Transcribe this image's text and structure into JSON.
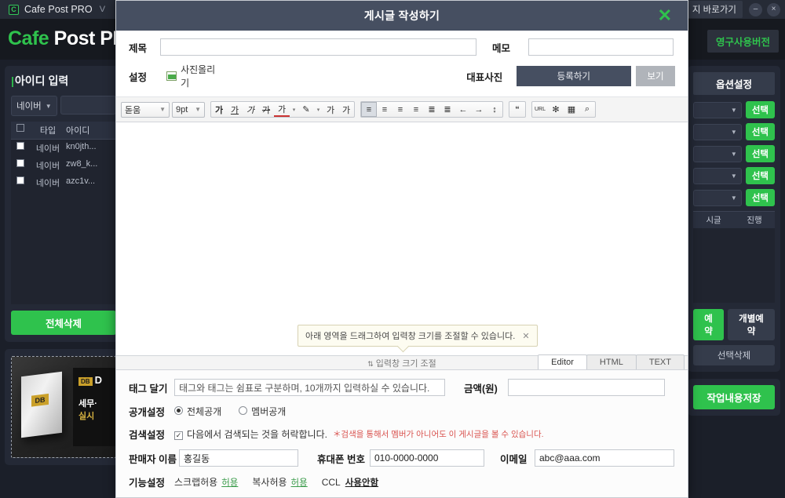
{
  "app": {
    "titlebar": {
      "logo": "C",
      "title": "Cafe Post PRO",
      "version": "V",
      "shortcut_label": "지 바로가기",
      "minimize": "–",
      "close": "×"
    },
    "brand": {
      "part1": "Cafe",
      "part2": "Post PR"
    },
    "permanent_badge": "영구사용버전"
  },
  "left_panel": {
    "title_bar": "|",
    "title": "아이디 입력",
    "site_select": "네이버",
    "columns": [
      "타입",
      "아이디"
    ],
    "rows": [
      {
        "type": "네이버",
        "id": "kn0jth..."
      },
      {
        "type": "네이버",
        "id": "zw8_k..."
      },
      {
        "type": "네이버",
        "id": "azc1v..."
      }
    ],
    "delete_all_button": "전체삭제",
    "promo": {
      "badge": "DB",
      "brand": "D",
      "box_label": "DB",
      "line1": "세무·",
      "line2": "실시"
    }
  },
  "right_panel": {
    "option_title": "옵션설정",
    "select_buttons": [
      "선택",
      "선택",
      "선택",
      "선택",
      "선택"
    ],
    "grid_columns": [
      "시글",
      "진행"
    ],
    "reserve_button": "예약",
    "individual_reserve_button": "개별예약",
    "delete_selected_button": "선택삭제",
    "save_work_button": "작업내용저장"
  },
  "modal": {
    "title": "게시글 작성하기",
    "close_icon": "✕",
    "meta": {
      "subject_label": "제목",
      "subject_value": "",
      "memo_label": "메모",
      "memo_value": "",
      "settings_label": "설정",
      "photo_upload_label": "사진올리기",
      "cover_label": "대표사진",
      "register_button": "등록하기",
      "view_button": "보기"
    },
    "toolbar": {
      "font_family": "돋움",
      "font_size": "9pt",
      "bold": "가",
      "underline": "가",
      "italic": "가",
      "strike": "가",
      "font_color": "가",
      "highlight": "✎",
      "superscript": "가",
      "subscript": "가",
      "align_left": "≡",
      "align_center": "≡",
      "align_right": "≡",
      "align_justify": "≡",
      "ordered_list": "≣",
      "unordered_list": "≣",
      "outdent": "←",
      "indent": "→",
      "line_height": "↕",
      "quote": "“",
      "link": "URL",
      "special_char": "✻",
      "table": "▦",
      "find": "⌕",
      "dropdown_caret": "▾"
    },
    "editor": {
      "content": "",
      "tip_text": "아래 영역을 드래그하여 입력창 크기를 조절할 수 있습니다.",
      "tip_close": "✕",
      "resize_label": "입력창 크기 조절",
      "resize_arrows": "⇅",
      "tabs": [
        {
          "label": "Editor",
          "active": true
        },
        {
          "label": "HTML",
          "active": false
        },
        {
          "label": "TEXT",
          "active": false
        }
      ]
    },
    "form": {
      "tag_label": "태그 달기",
      "tag_value": "태그와 태그는 쉼표로 구분하며, 10개까지 입력하실 수 있습니다.",
      "price_label": "금액(원)",
      "price_value": "",
      "privacy_label": "공개설정",
      "privacy_options": [
        {
          "label": "전체공개",
          "selected": true
        },
        {
          "label": "멤버공개",
          "selected": false
        }
      ],
      "search_label": "검색설정",
      "search_checkbox_label": "다음에서 검색되는 것을 허락합니다.",
      "search_checked": "✓",
      "search_note": "＊검색을 통해서 멤버가 아니어도 이 게시글을 볼 수 있습니다.",
      "seller_label": "판매자 이름",
      "seller_value": "홍길동",
      "phone_label": "휴대폰 번호",
      "phone_value": "010-0000-0000",
      "email_label": "이메일",
      "email_value": "abc@aaa.com",
      "feature_label": "기능설정",
      "scrap_label": "스크랩허용",
      "scrap_value": "허용",
      "copy_label": "복사허용",
      "copy_value": "허용",
      "ccl_label": "CCL",
      "ccl_value": "사용안함"
    }
  },
  "colors": {
    "accent_green": "#2fc24d",
    "modal_bar": "#464f61",
    "app_bg": "#1b1f29",
    "panel_bg": "#242936"
  }
}
